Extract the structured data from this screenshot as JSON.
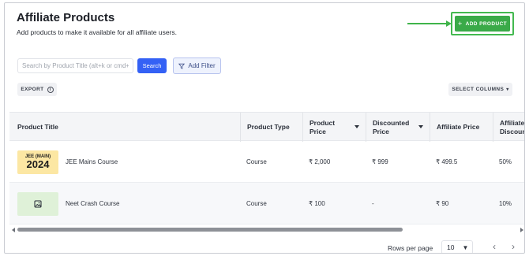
{
  "header": {
    "title": "Affiliate Products",
    "subtitle": "Add products to make it available for all affiliate users.",
    "add_button": "ADD PRODUCT",
    "add_icon": "+"
  },
  "toolbar": {
    "search_placeholder": "Search by Product Title (alt+k or cmd+k)",
    "search_button": "Search",
    "filter_button": "Add Filter",
    "export_button": "EXPORT",
    "columns_button": "SELECT COLUMNS"
  },
  "table": {
    "columns": [
      {
        "label": "Product Title",
        "sortable": false
      },
      {
        "label": "Product Type",
        "sortable": false
      },
      {
        "label": "Product\nPrice",
        "sortable": true
      },
      {
        "label": "Discounted\nPrice",
        "sortable": true
      },
      {
        "label": "Affiliate Price",
        "sortable": false
      },
      {
        "label": "Affiliate\nDiscount",
        "sortable": false
      }
    ],
    "rows": [
      {
        "thumb_line1": "JEE (MAIN)",
        "thumb_line2": "2024",
        "title": "JEE Mains Course",
        "type": "Course",
        "price": "₹ 2,000",
        "discounted": "₹ 999",
        "affiliate_price": "₹ 499.5",
        "affiliate_discount": "50%"
      },
      {
        "thumb_icon": "image-icon",
        "title": "Neet Crash Course",
        "type": "Course",
        "price": "₹ 100",
        "discounted": "-",
        "affiliate_price": "₹ 90",
        "affiliate_discount": "10%"
      }
    ]
  },
  "pagination": {
    "rows_per_page_label": "Rows per page",
    "rows_per_page_value": "10",
    "prev_icon": "‹",
    "next_icon": "›"
  },
  "colors": {
    "accent_green": "#3aaa48",
    "search_blue": "#3461f5"
  }
}
